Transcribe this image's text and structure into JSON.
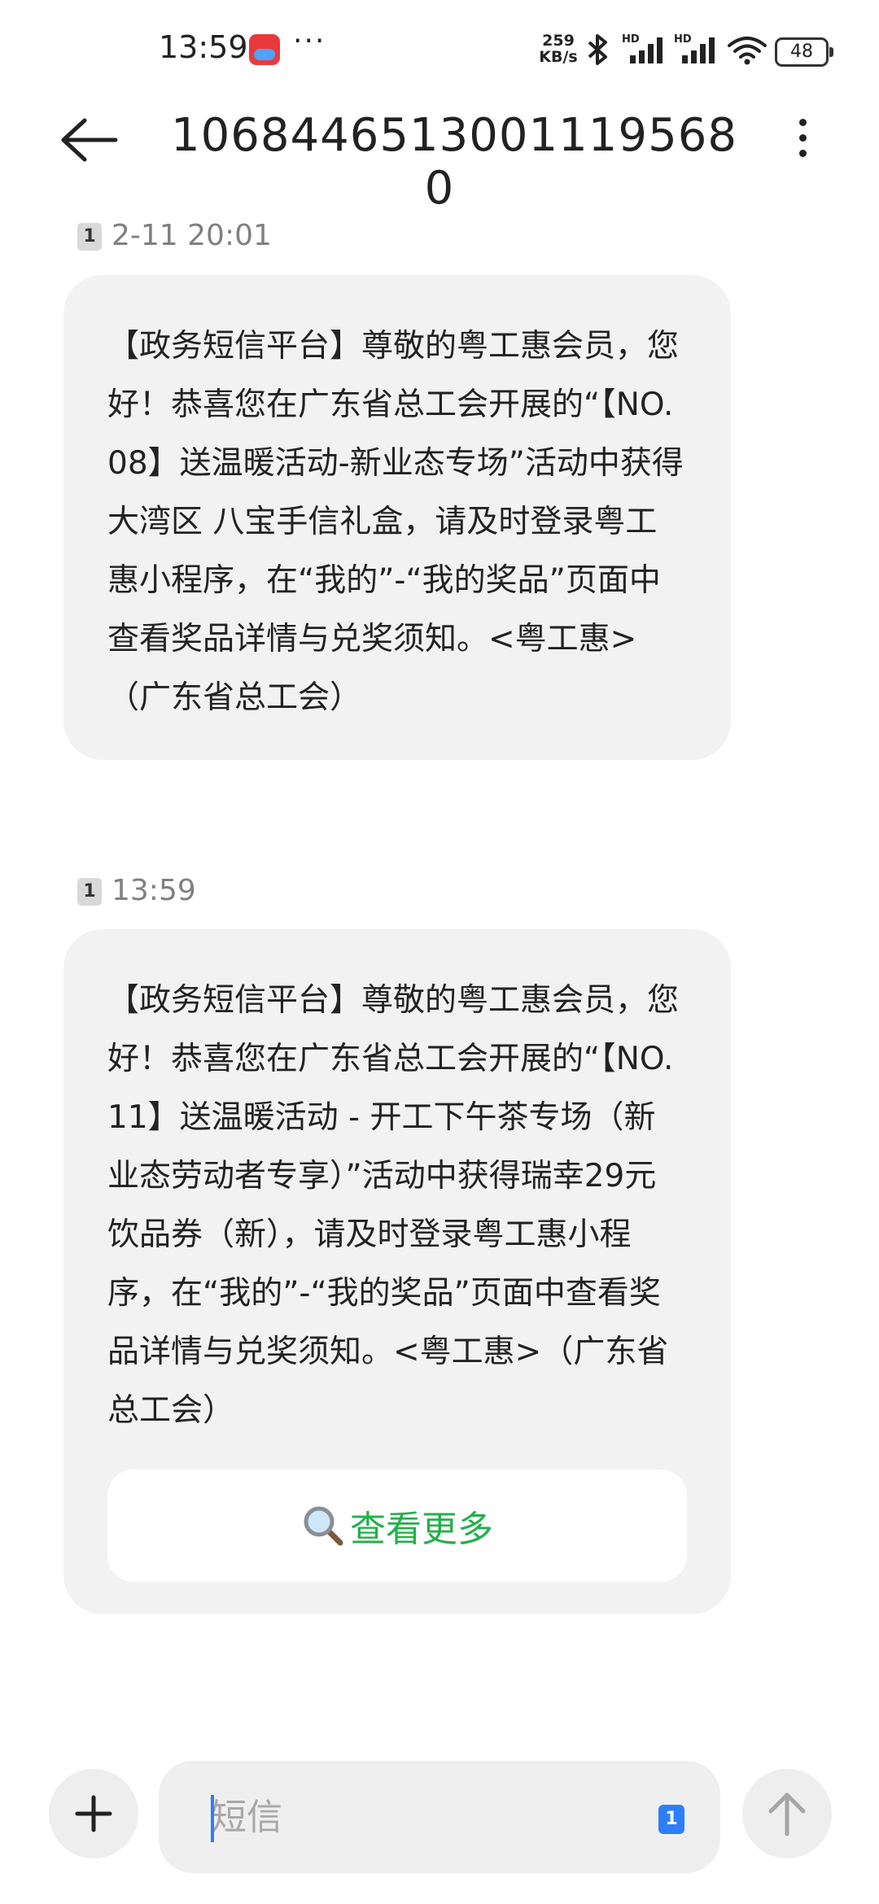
{
  "status_bar": {
    "time": "13:59",
    "more": "···",
    "speed_value": "259",
    "speed_unit": "KB/s",
    "battery": "48",
    "icons": [
      "app-notification-icon",
      "bluetooth-icon",
      "hd-signal-icon",
      "hd-signal-icon",
      "wifi-icon",
      "battery-icon"
    ]
  },
  "header": {
    "title": "1068446513001119568​0",
    "back_icon": "arrow-left-icon",
    "menu_icon": "more-vertical-icon"
  },
  "messages": [
    {
      "sim": "1",
      "timestamp": "2-11 20:01",
      "text": "【政务短信平台】尊敬的粤工惠会员，您好！恭喜您在广东省总工会开展的“【NO.08】送温暖活动-新业态专场”活动中获得大湾区 八宝手信礼盒，请及时登录粤工惠小程序，在“我的”-“我的奖品”页面中查看奖品详情与兑奖须知。<粤工惠>（广东省总工会）"
    },
    {
      "sim": "1",
      "timestamp": "13:59",
      "text": "【政务短信平台】尊敬的粤工惠会员，您好！恭喜您在广东省总工会开展的“【NO.11】送温暖活动 - 开工下午茶专场（新业态劳动者专享）”活动中获得瑞幸29元饮品券（新），请及时登录粤工惠小程序，在“我的”-“我的奖品”页面中查看奖品详情与兑奖须知。<粤工惠>（广东省总工会）",
      "action_label": "查看更多",
      "action_icon": "magnifier-icon"
    }
  ],
  "composer": {
    "placeholder": "短信",
    "sim": "1",
    "add_icon": "plus-icon",
    "send_icon": "arrow-up-icon"
  },
  "colors": {
    "bubble": "#f2f2f2",
    "accent_green": "#23b04a",
    "accent_blue": "#2d7ff9"
  }
}
